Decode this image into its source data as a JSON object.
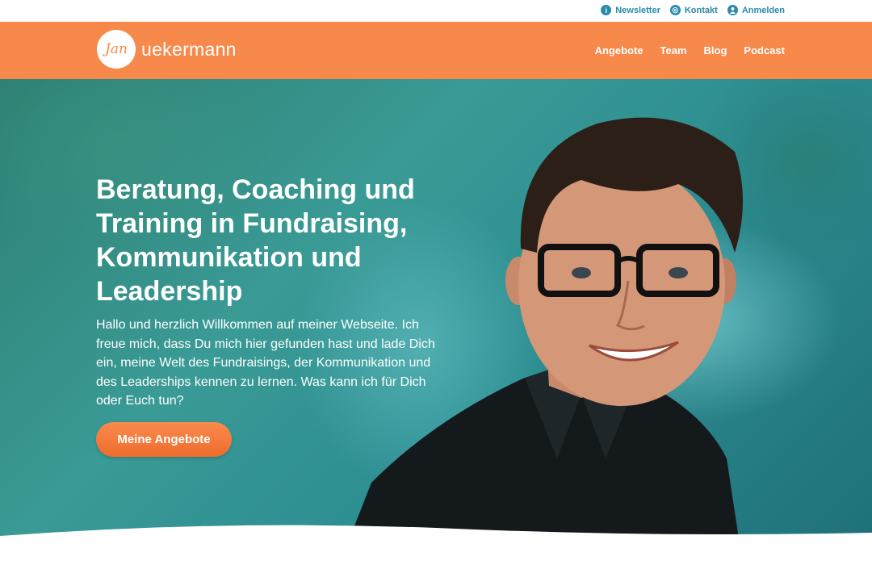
{
  "topbar": {
    "links": [
      {
        "label": "Newsletter",
        "icon": "info-icon"
      },
      {
        "label": "Kontakt",
        "icon": "globe-icon"
      },
      {
        "label": "Anmelden",
        "icon": "user-icon"
      }
    ]
  },
  "header": {
    "logo_text": "uekermann",
    "logo_mark": "Jan",
    "nav": [
      "Angebote",
      "Team",
      "Blog",
      "Podcast"
    ],
    "color": "#f7894a"
  },
  "hero": {
    "title": "Beratung, Coaching und Training in Fundraising, Kommunikation und Leadership",
    "body": "Hallo und herzlich Willkommen auf meiner Webseite. Ich freue mich, dass Du mich hier gefunden hast und lade Dich ein, meine Welt des Fundraisings, der Kommunikation und des Leaderships kennen zu lernen. Was kann ich für Dich oder Euch tun?",
    "cta_label": "Meine Angebote"
  },
  "colors": {
    "accent": "#f7894a",
    "link": "#2a8aab",
    "hero_bg": "#2d8e92"
  }
}
